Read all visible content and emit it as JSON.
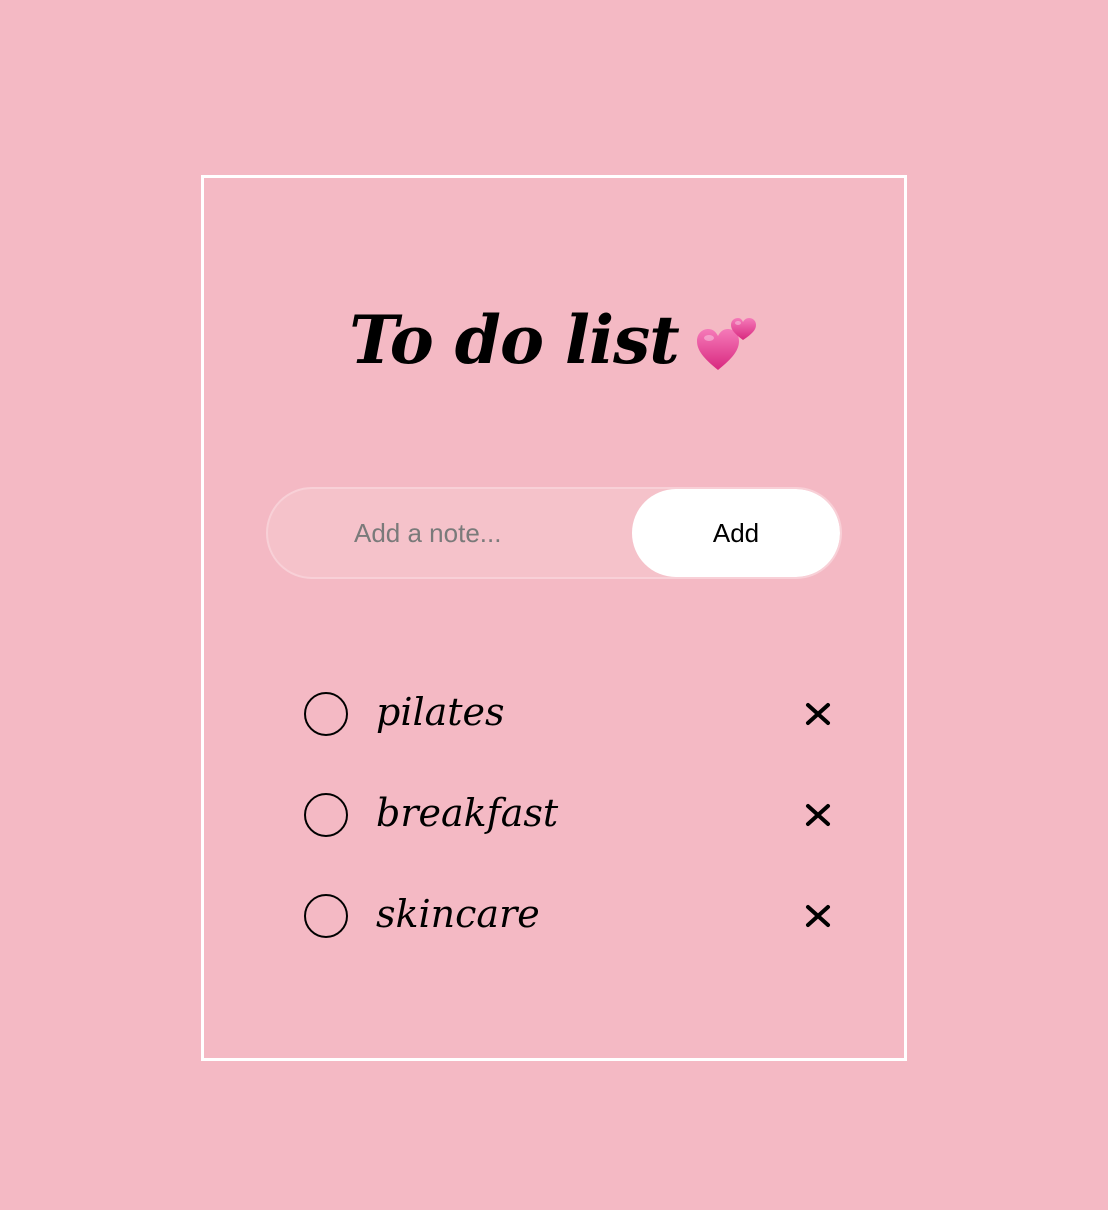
{
  "header": {
    "title": "To do list",
    "title_emoji": "two-hearts-icon"
  },
  "form": {
    "input_value": "",
    "placeholder": "Add a note...",
    "add_label": "Add"
  },
  "todos": [
    {
      "label": "pilates",
      "done": false
    },
    {
      "label": "breakfast",
      "done": false
    },
    {
      "label": "skincare",
      "done": false
    }
  ],
  "colors": {
    "background": "#f4b9c4",
    "card_border": "#ffffff",
    "heart_pink": "#e64f9c"
  }
}
